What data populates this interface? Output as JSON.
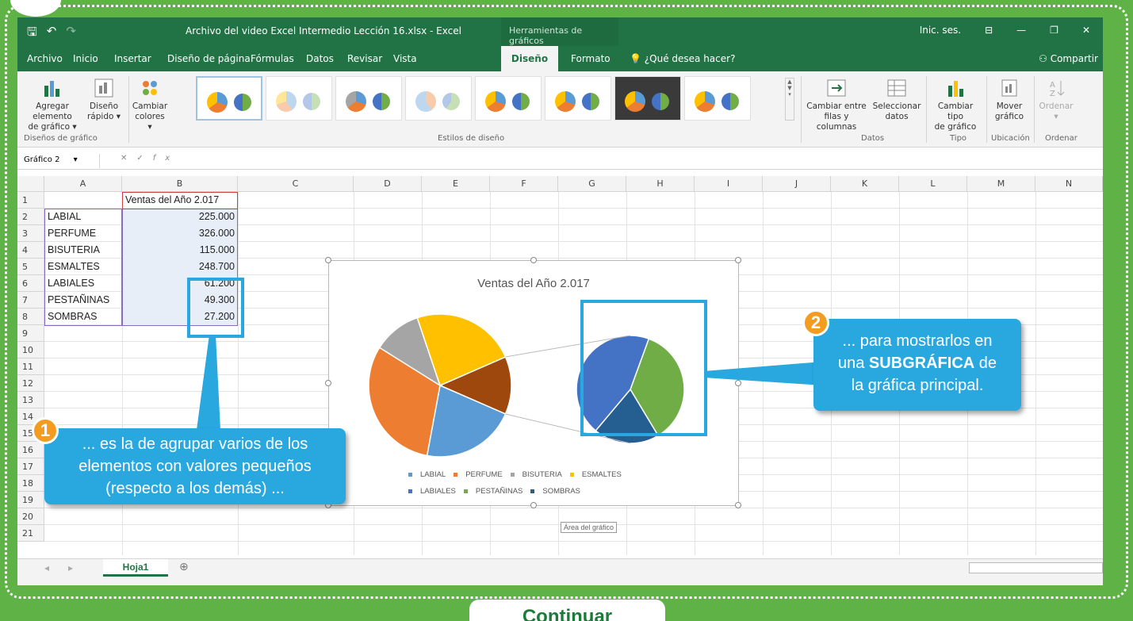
{
  "window": {
    "title": "Archivo del video Excel Intermedio Lección 16.xlsx  -  Excel",
    "contextual_tab": "Herramientas de gráficos",
    "signin": "Inic. ses.",
    "qa_icons": [
      "save-icon",
      "undo-icon",
      "redo-icon"
    ]
  },
  "menu": {
    "tabs": [
      "Archivo",
      "Inicio",
      "Insertar",
      "Diseño de página",
      "Fórmulas",
      "Datos",
      "Revisar",
      "Vista",
      "Diseño",
      "Formato"
    ],
    "active": "Diseño",
    "tell_me": "¿Qué desea hacer?",
    "share": "Compartir"
  },
  "ribbon": {
    "add_element_1": "Agregar elemento",
    "add_element_2": "de gráfico ▾",
    "quick_layout_1": "Diseño",
    "quick_layout_2": "rápido ▾",
    "change_colors_1": "Cambiar",
    "change_colors_2": "colores ▾",
    "group_layouts": "Diseños de gráfico",
    "group_styles": "Estilos de diseño",
    "switch_1": "Cambiar entre",
    "switch_2": "filas y columnas",
    "select_data_1": "Seleccionar",
    "select_data_2": "datos",
    "group_data": "Datos",
    "change_type_1": "Cambiar tipo",
    "change_type_2": "de gráfico",
    "group_type": "Tipo",
    "move_1": "Mover",
    "move_2": "gráfico",
    "group_location": "Ubicación",
    "order": "Ordenar",
    "group_order": "Ordenar"
  },
  "formula_bar": {
    "name_box": "Gráfico 2",
    "fx": "fx"
  },
  "columns": [
    "A",
    "B",
    "C",
    "D",
    "E",
    "F",
    "G",
    "H",
    "I",
    "J",
    "K",
    "L",
    "M",
    "N"
  ],
  "rows": [
    "1",
    "2",
    "3",
    "4",
    "5",
    "6",
    "7",
    "8",
    "9",
    "10",
    "11",
    "12",
    "13",
    "14",
    "15",
    "16",
    "17",
    "18",
    "19",
    "20",
    "21"
  ],
  "cells": {
    "b1": "Ventas del Año 2.017",
    "labels": [
      "LABIAL",
      "PERFUME",
      "BISUTERIA",
      "ESMALTES",
      "LABIALES",
      "PESTAÑINAS",
      "SOMBRAS"
    ],
    "values": [
      "225.000",
      "326.000",
      "115.000",
      "248.700",
      "61.200",
      "49.300",
      "27.200"
    ]
  },
  "chart_data": {
    "type": "pie",
    "title": "Ventas del Año 2.017",
    "categories": [
      "LABIAL",
      "PERFUME",
      "BISUTERIA",
      "ESMALTES",
      "LABIALES",
      "PESTAÑINAS",
      "SOMBRAS"
    ],
    "values": [
      225000,
      326000,
      115000,
      248700,
      61200,
      49300,
      27200
    ],
    "colors": [
      "#5b9bd5",
      "#ed7d31",
      "#a5a5a5",
      "#ffc000",
      "#4472c4",
      "#70ad47",
      "#255e91"
    ],
    "subchart": "pie of pie"
  },
  "tooltip": "Área del gráfico",
  "sheet_tab": "Hoja1",
  "callout1": {
    "badge": "1",
    "line1": "... es la de agrupar varios de los",
    "line2": "elementos con valores pequeños",
    "line3": "(respecto a los demás) ..."
  },
  "callout2": {
    "badge": "2",
    "line1": "... para mostrarlos en",
    "line2_pre": "una ",
    "line2_bold": "SUBGRÁFICA",
    "line2_post": " de",
    "line3": "la gráfica principal."
  },
  "continue": "Continuar"
}
